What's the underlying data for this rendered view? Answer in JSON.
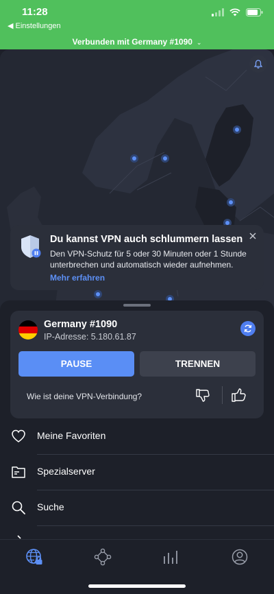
{
  "status_bar": {
    "time": "11:28",
    "back_app": "Einstellungen",
    "connection_title": "Verbunden mit Germany #1090"
  },
  "notification": {
    "title": "Du kannst VPN auch schlummern lassen",
    "body": "Den VPN-Schutz für 5 oder 30 Minuten oder 1 Stunde unterbrechen und automatisch wieder aufnehmen.",
    "link": "Mehr erfahren"
  },
  "server": {
    "name": "Germany #1090",
    "ip": "IP-Adresse: 5.180.61.87",
    "flag_colors": [
      "#000000",
      "#dd0000",
      "#ffce00"
    ]
  },
  "actions": {
    "pause": "PAUSE",
    "disconnect": "TRENNEN"
  },
  "feedback": {
    "question": "Wie ist deine VPN-Verbindung?"
  },
  "menu": [
    {
      "label": "Meine Favoriten",
      "icon": "heart-icon"
    },
    {
      "label": "Spezialserver",
      "icon": "folder-icon"
    },
    {
      "label": "Suche",
      "icon": "search-icon"
    }
  ],
  "tabs": [
    {
      "name": "globe-lock",
      "active": true
    },
    {
      "name": "meshnet",
      "active": false
    },
    {
      "name": "stats",
      "active": false
    },
    {
      "name": "profile",
      "active": false
    }
  ],
  "colors": {
    "status_green": "#50c05c",
    "accent_blue": "#5a8ef5",
    "background": "#1d2029",
    "card": "#2b2f3a"
  }
}
